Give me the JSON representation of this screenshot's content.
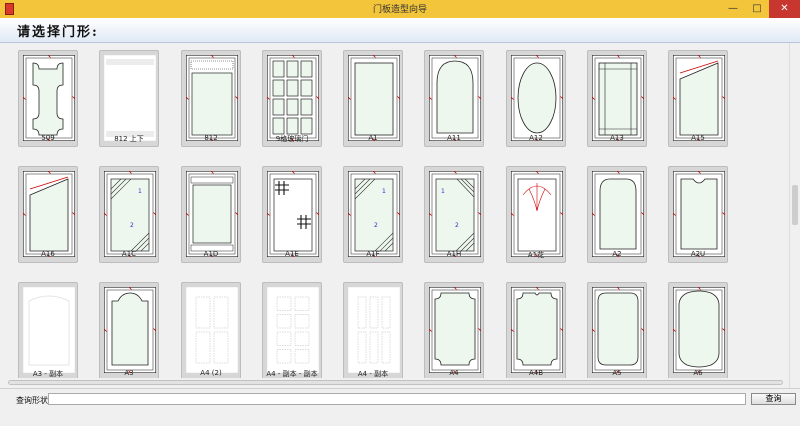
{
  "window": {
    "title": "门板造型向导",
    "min_glyph": "—",
    "max_glyph": "□",
    "close_glyph": "✕"
  },
  "header": {
    "prompt": "请选择门形:"
  },
  "colors": {
    "titlebar": "#f3c53b",
    "header": "#dfe9f5",
    "card": "#d7d7d7",
    "mark": "#cc0000",
    "panel_fill": "#eef7ee"
  },
  "cards": [
    {
      "label": "509",
      "style": "corner-round"
    },
    {
      "label": "812 上下",
      "style": "blank-bands"
    },
    {
      "label": "812",
      "style": "top-band"
    },
    {
      "label": "9格玻璃门",
      "style": "grid-9"
    },
    {
      "label": "A1",
      "style": "rect"
    },
    {
      "label": "A11",
      "style": "arch"
    },
    {
      "label": "A12",
      "style": "oval"
    },
    {
      "label": "A13",
      "style": "rect-frame"
    },
    {
      "label": "A15",
      "style": "slant-top"
    },
    {
      "label": "A16",
      "style": "slant-top2"
    },
    {
      "label": "A1C",
      "style": "corner-hatch"
    },
    {
      "label": "A1D",
      "style": "top-bottom-band"
    },
    {
      "label": "A1E",
      "style": "cross-marks"
    },
    {
      "label": "A1F",
      "style": "corner-hatch"
    },
    {
      "label": "A1H",
      "style": "corner-hatch2"
    },
    {
      "label": "A1花",
      "style": "flower"
    },
    {
      "label": "A2",
      "style": "arch-flat"
    },
    {
      "label": "A2U",
      "style": "notch-top"
    },
    {
      "label": "A3 - 副本",
      "style": "blank-shield"
    },
    {
      "label": "A3",
      "style": "shield"
    },
    {
      "label": "A4 (2)",
      "style": "grid-4-ghost"
    },
    {
      "label": "A4 - 副本 - 副本",
      "style": "grid-8-ghost"
    },
    {
      "label": "A4 - 副本",
      "style": "grid-6-ghost"
    },
    {
      "label": "A4",
      "style": "concave"
    },
    {
      "label": "A4B",
      "style": "concave2"
    },
    {
      "label": "A5",
      "style": "round-rect"
    },
    {
      "label": "A6",
      "style": "octa-round"
    }
  ],
  "search": {
    "label": "查询形状",
    "value": "",
    "button": "查询"
  }
}
